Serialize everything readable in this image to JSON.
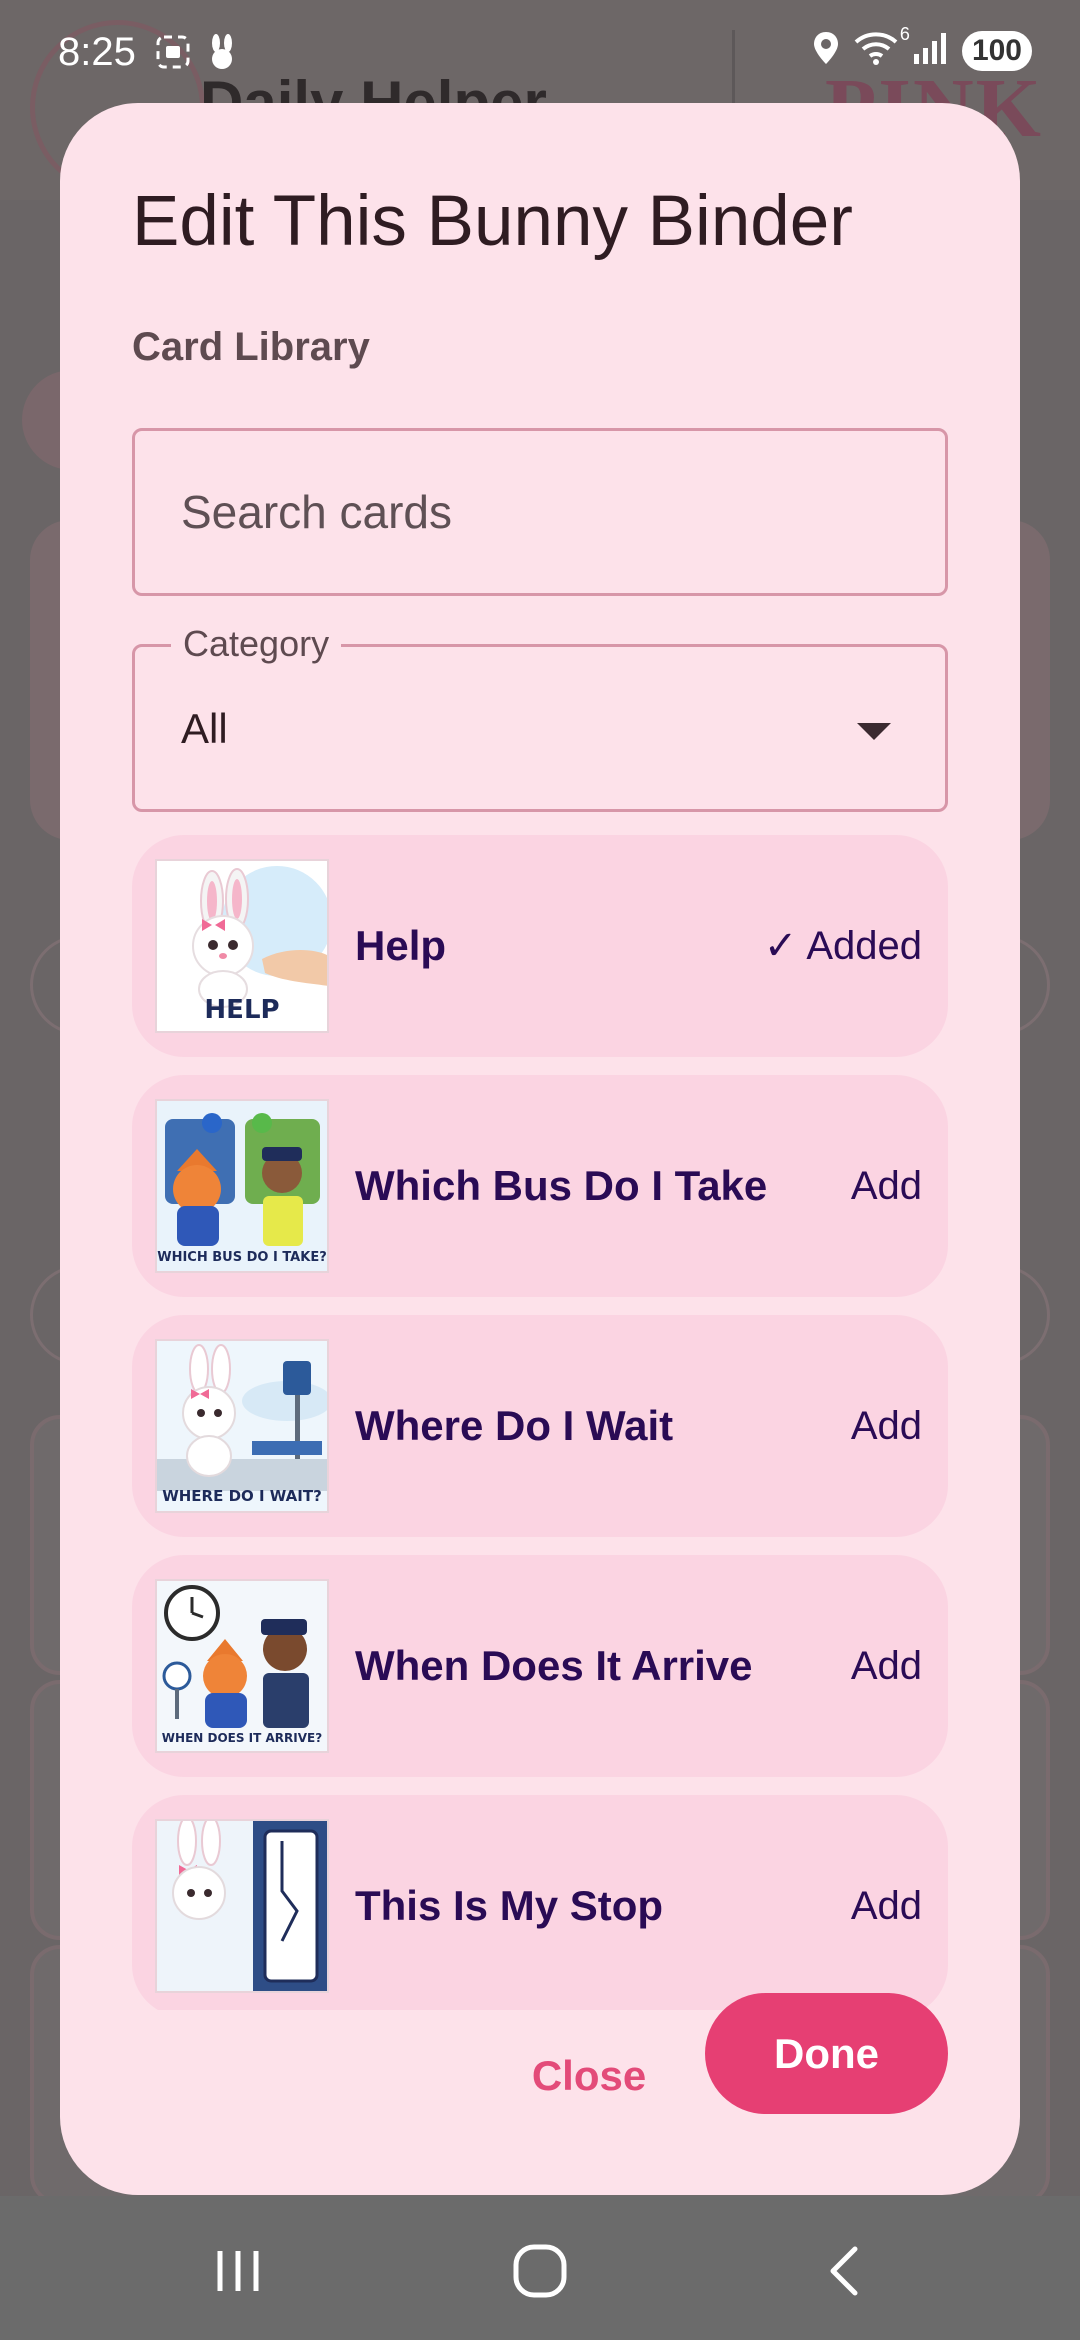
{
  "status_bar": {
    "time": "8:25",
    "battery": "100",
    "wifi_badge": "6",
    "left_icons": [
      "screenshot-icon",
      "bunny-app-icon"
    ],
    "right_icons": [
      "location-icon",
      "wifi-icon",
      "signal-icon",
      "battery-icon"
    ]
  },
  "background_app": {
    "title": "Daily Helper",
    "brand": "PINK"
  },
  "dialog": {
    "title": "Edit This Bunny Binder",
    "section_label": "Card Library",
    "search": {
      "placeholder": "Search cards",
      "value": ""
    },
    "category": {
      "label": "Category",
      "value": "All"
    },
    "cards": [
      {
        "name": "Help",
        "action": "✓ Added",
        "thumb_caption": "HELP"
      },
      {
        "name": "Which Bus Do I Take",
        "action": "Add",
        "thumb_caption": "WHICH BUS DO I TAKE?"
      },
      {
        "name": "Where Do I Wait",
        "action": "Add",
        "thumb_caption": "WHERE DO I WAIT?"
      },
      {
        "name": "When Does It Arrive",
        "action": "Add",
        "thumb_caption": "WHEN DOES IT ARRIVE?"
      },
      {
        "name": "This Is My Stop",
        "action": "Add",
        "thumb_caption": ""
      }
    ],
    "close_label": "Close",
    "done_label": "Done"
  },
  "colors": {
    "dialog_bg": "#fde2ea",
    "card_bg": "#fbd4e2",
    "accent": "#e63f73",
    "card_text": "#2a0b55",
    "scrim": "#6b6b6b"
  },
  "nav_bar": {
    "icons": [
      "recents-icon",
      "home-icon",
      "back-icon"
    ]
  }
}
